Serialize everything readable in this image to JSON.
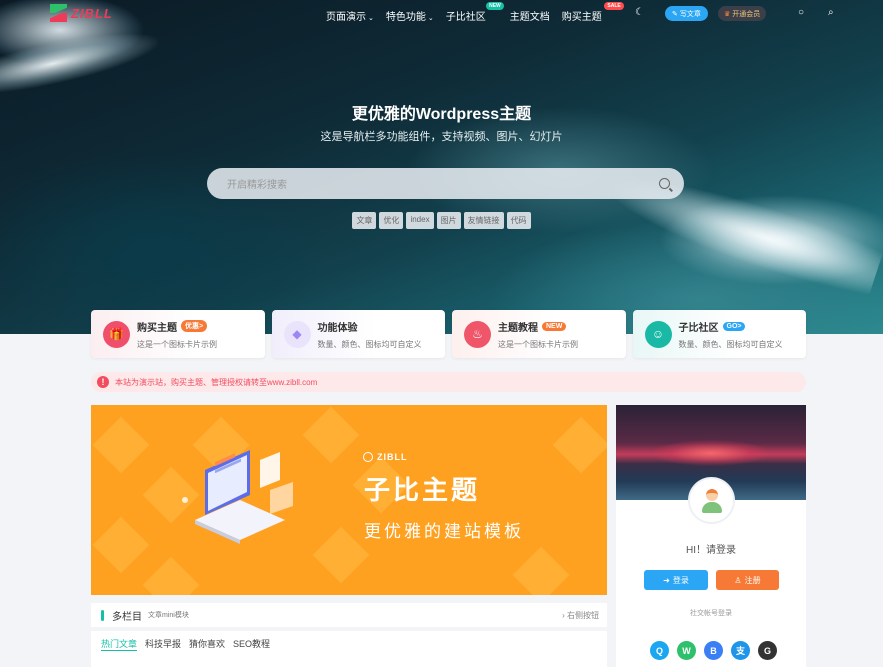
{
  "brand": {
    "logo_text": "ZIBLL"
  },
  "nav": {
    "items": [
      {
        "label": "页面演示",
        "caret": "⌄"
      },
      {
        "label": "特色功能",
        "caret": "⌄"
      },
      {
        "label": "子比社区",
        "badge": "NEW"
      },
      {
        "label": "主题文档"
      },
      {
        "label": "购买主题",
        "badge": "SALE"
      }
    ],
    "write_label": "写文章",
    "vip_label": "开通会员",
    "icons": [
      "moon-icon",
      "lightbulb-icon",
      "search-icon"
    ]
  },
  "hero": {
    "title": "更优雅的Wordpress主题",
    "subtitle": "这是导航栏多功能组件，支持视频、图片、幻灯片",
    "search_placeholder": "开启精彩搜索",
    "tags": [
      "文章",
      "优化",
      "index",
      "图片",
      "友情链接",
      "代码"
    ]
  },
  "cards": [
    {
      "title": "购买主题",
      "badge": "优惠>",
      "desc": "这是一个图标卡片示例",
      "icon": "gift-icon",
      "color": "#f04f6b",
      "badge_color": "#f67a36"
    },
    {
      "title": "功能体验",
      "desc": "数量、颜色、图标均可自定义",
      "icon": "diamond-icon",
      "color": "#9b87f5"
    },
    {
      "title": "主题教程",
      "badge": "NEW",
      "desc": "这是一个图标卡片示例",
      "icon": "fire-icon",
      "color": "#f0566a",
      "badge_color": "#f67a36"
    },
    {
      "title": "子比社区",
      "badge": "GO>",
      "desc": "数量、颜色、图标均可自定义",
      "icon": "community-icon",
      "color": "#19b9a5",
      "badge_color": "#2ba6f5"
    }
  ],
  "notice": {
    "text": "本站为演示站，购买主题、管理授权请转至www.zibll.com"
  },
  "banner": {
    "brand": "ZIBLL",
    "headline": "子比主题",
    "tagline": "更优雅的建站模板"
  },
  "column": {
    "title": "多栏目",
    "subtitle": "文章mini模块",
    "right_label": "右侧按钮",
    "tabs": [
      "热门文章",
      "科技早报",
      "猜你喜欢",
      "SEO教程"
    ],
    "active_tab": 0
  },
  "user_card": {
    "greeting": "HI！请登录",
    "login_label": "登录",
    "register_label": "注册",
    "social_label": "社交帐号登录",
    "socials": [
      {
        "icon": "qq-icon",
        "color": "#1aa6f0",
        "glyph": "Q"
      },
      {
        "icon": "wechat-icon",
        "color": "#2ec06b",
        "glyph": "W"
      },
      {
        "icon": "baidu-icon",
        "color": "#3a7ff5",
        "glyph": "B"
      },
      {
        "icon": "alipay-icon",
        "color": "#1f95ea",
        "glyph": "支"
      },
      {
        "icon": "github-icon",
        "color": "#333333",
        "glyph": "G"
      }
    ]
  }
}
